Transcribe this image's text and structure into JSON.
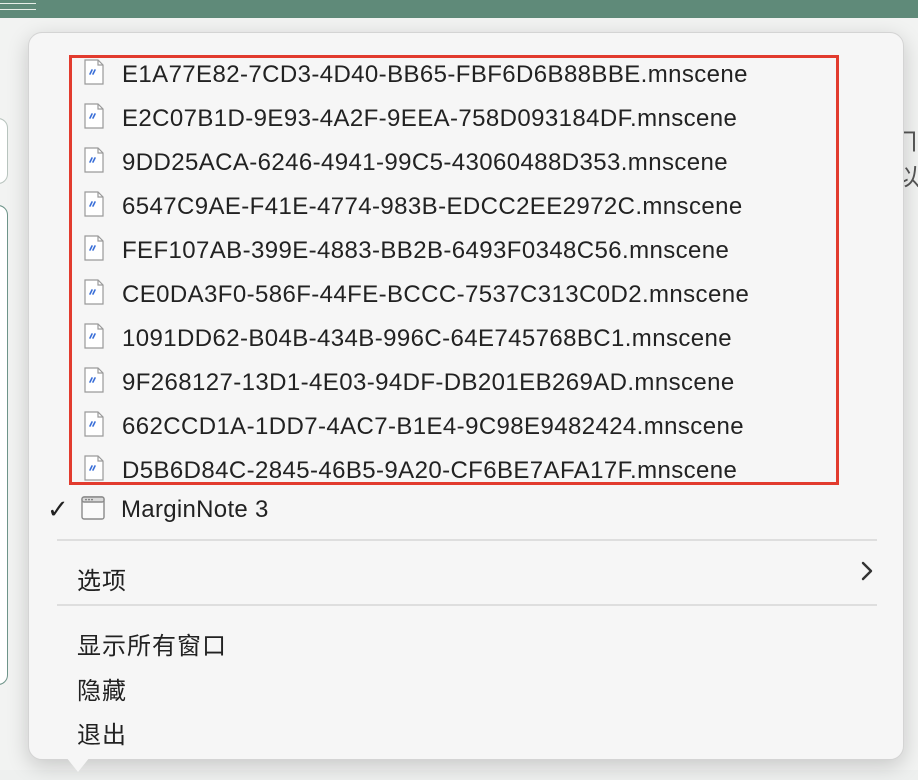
{
  "menu": {
    "recent_files": [
      "E1A77E82-7CD3-4D40-BB65-FBF6D6B88BBE.mnscene",
      "E2C07B1D-9E93-4A2F-9EEA-758D093184DF.mnscene",
      "9DD25ACA-6246-4941-99C5-43060488D353.mnscene",
      "6547C9AE-F41E-4774-983B-EDCC2EE2972C.mnscene",
      "FEF107AB-399E-4883-BB2B-6493F0348C56.mnscene",
      "CE0DA3F0-586F-44FE-BCCC-7537C313C0D2.mnscene",
      "1091DD62-B04B-434B-996C-64E745768BC1.mnscene",
      "9F268127-13D1-4E03-94DF-DB201EB269AD.mnscene",
      "662CCD1A-1DD7-4AC7-B1E4-9C98E9482424.mnscene",
      "D5B6D84C-2845-46B5-9A20-CF6BE7AFA17F.mnscene"
    ],
    "checkmark": "✓",
    "app_window": "MarginNote 3",
    "options_label": "选项",
    "show_all_windows": "显示所有窗口",
    "hide": "隐藏",
    "quit": "退出"
  },
  "colors": {
    "highlight_border": "#e23b2e",
    "title_bar": "#5f8a79",
    "file_icon_glyph": "#3a6fd8"
  },
  "icons": {
    "file": "document-icon",
    "app": "window-icon",
    "submenu": "chevron-right-icon"
  }
}
